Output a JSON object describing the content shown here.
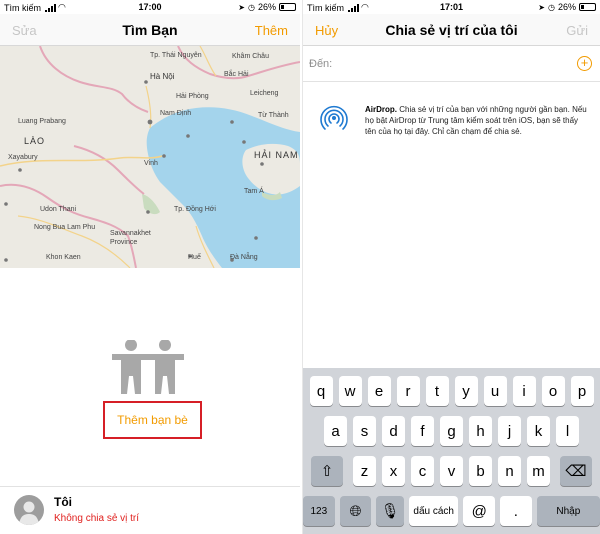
{
  "left": {
    "status": {
      "carrier": "Tìm kiếm",
      "time": "17:00",
      "battery": "26%",
      "battery_level": 0.26
    },
    "nav": {
      "left": "Sửa",
      "title": "Tìm Bạn",
      "right": "Thêm"
    },
    "map": {
      "labels": [
        {
          "text": "Tp. Thái Nguyên",
          "cls": ""
        },
        {
          "text": "Khâm Châu",
          "cls": ""
        },
        {
          "text": "Hà Nội",
          "cls": "big"
        },
        {
          "text": "Bắc Hải",
          "cls": ""
        },
        {
          "text": "Hải Phòng",
          "cls": ""
        },
        {
          "text": "Leicheng",
          "cls": ""
        },
        {
          "text": "Luang Prabang",
          "cls": ""
        },
        {
          "text": "Nam Định",
          "cls": ""
        },
        {
          "text": "Từ Thành",
          "cls": ""
        },
        {
          "text": "LÀO",
          "cls": "country"
        },
        {
          "text": "HẢI NAM",
          "cls": "country"
        },
        {
          "text": "Xayabury",
          "cls": ""
        },
        {
          "text": "Vinh",
          "cls": ""
        },
        {
          "text": "Tam Á",
          "cls": ""
        },
        {
          "text": "Udon Thani",
          "cls": ""
        },
        {
          "text": "Tp. Đồng Hới",
          "cls": ""
        },
        {
          "text": "Nong Bua Lam Phu",
          "cls": ""
        },
        {
          "text": "Savannakhet",
          "cls": ""
        },
        {
          "text": "Province",
          "cls": ""
        },
        {
          "text": "Khon Kaen",
          "cls": ""
        },
        {
          "text": "Huế",
          "cls": ""
        },
        {
          "text": "Đà Nẵng",
          "cls": ""
        }
      ]
    },
    "add_friends": "Thêm bạn bè",
    "me": {
      "name": "Tôi",
      "status": "Không chia sẻ vị trí"
    }
  },
  "right": {
    "status": {
      "carrier": "Tìm kiếm",
      "time": "17:01",
      "battery": "26%",
      "battery_level": 0.26
    },
    "nav": {
      "left": "Hủy",
      "title": "Chia sẻ vị trí của tôi",
      "right": "Gửi"
    },
    "to_label": "Đến:",
    "airdrop": {
      "bold": "AirDrop.",
      "text": " Chia sẻ vị trí của bạn với những người gần bạn. Nếu họ bật AirDrop từ Trung tâm kiểm soát trên iOS, bạn sẽ thấy tên của họ tại đây. Chỉ cần chạm để chia sẻ."
    },
    "keyboard": {
      "row1": [
        "q",
        "w",
        "e",
        "r",
        "t",
        "y",
        "u",
        "i",
        "o",
        "p"
      ],
      "row2": [
        "a",
        "s",
        "d",
        "f",
        "g",
        "h",
        "j",
        "k",
        "l"
      ],
      "row3": [
        "z",
        "x",
        "c",
        "v",
        "b",
        "n",
        "m"
      ],
      "num": "123",
      "space": "dấu cách",
      "at": "@",
      "dot": ".",
      "return": "Nhập"
    }
  },
  "colors": {
    "accent": "#f29b00",
    "highlight_box": "#d61f26",
    "status_red": "#e0201e",
    "sea": "#a4d4ec"
  }
}
